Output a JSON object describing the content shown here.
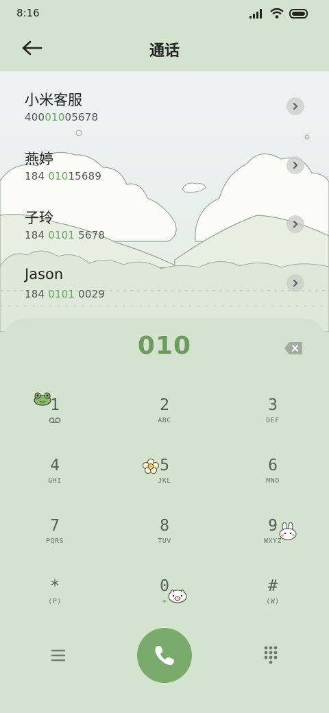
{
  "status": {
    "time": "8:16",
    "icons": [
      "signal-icon",
      "wifi-icon",
      "battery-icon"
    ]
  },
  "header": {
    "title": "通话",
    "back_icon": "arrow-left-icon"
  },
  "contacts": [
    {
      "name": "小米客服",
      "number_pre": "400",
      "number_hl": "010",
      "number_post": "05678"
    },
    {
      "name": "燕婷",
      "number_pre": "184 ",
      "number_hl": "010",
      "number_post": "15689"
    },
    {
      "name": "子玲",
      "number_pre": "184 ",
      "number_hl": "0101",
      "number_post": " 5678"
    },
    {
      "name": "Jason",
      "number_pre": "184 ",
      "number_hl": "0101",
      "number_post": " 0029"
    }
  ],
  "dialpad": {
    "entered": "010",
    "keys": [
      {
        "digit": "1",
        "letters": ""
      },
      {
        "digit": "2",
        "letters": "ABC"
      },
      {
        "digit": "3",
        "letters": "DEF"
      },
      {
        "digit": "4",
        "letters": "GHI"
      },
      {
        "digit": "5",
        "letters": "JKL"
      },
      {
        "digit": "6",
        "letters": "MNO"
      },
      {
        "digit": "7",
        "letters": "PQRS"
      },
      {
        "digit": "8",
        "letters": "TUV"
      },
      {
        "digit": "9",
        "letters": "WXYZ"
      },
      {
        "digit": "*",
        "letters": "(P)"
      },
      {
        "digit": "0",
        "letters": "+"
      },
      {
        "digit": "#",
        "letters": "(W)"
      }
    ]
  },
  "colors": {
    "background": "#d3e3cd",
    "accent": "#6c9b61",
    "call_button": "#7aab6c",
    "highlight": "#6aa460"
  }
}
